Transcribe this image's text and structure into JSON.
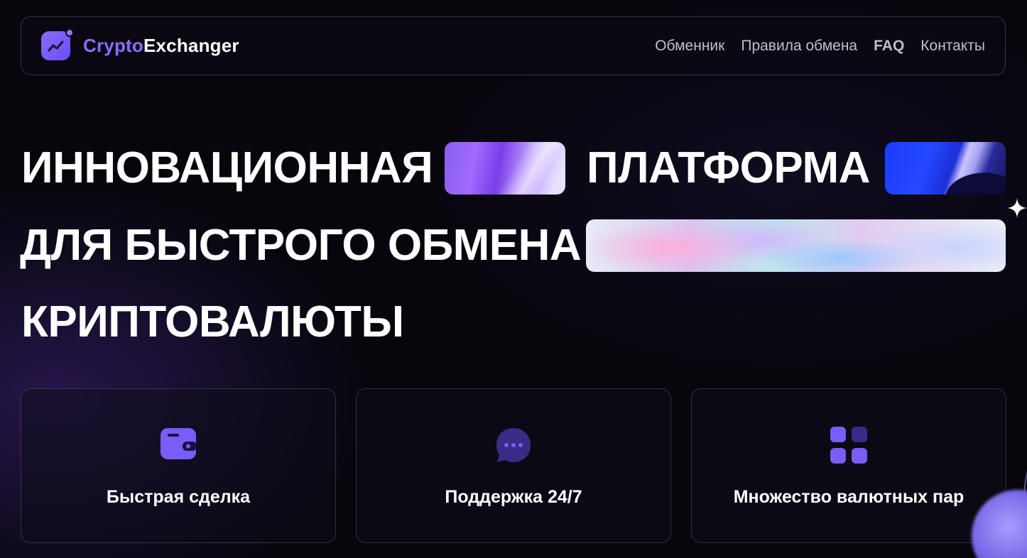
{
  "brand": {
    "name_accent": "Crypto",
    "name_rest": "Exchanger"
  },
  "nav": {
    "items": [
      {
        "label": "Обменник"
      },
      {
        "label": "Правила обмена"
      },
      {
        "label": "FAQ"
      },
      {
        "label": "Контакты"
      }
    ]
  },
  "hero": {
    "line1_word1": "ИННОВАЦИОННАЯ",
    "line1_word2": "ПЛАТФОРМА",
    "line2": "ДЛЯ БЫСТРОГО ОБМЕНА",
    "line3": "КРИПТОВАЛЮТЫ"
  },
  "features": [
    {
      "label": "Быстрая сделка",
      "icon": "wallet-icon"
    },
    {
      "label": "Поддержка 24/7",
      "icon": "chat-bubble-icon"
    },
    {
      "label": "Множество валютных пар",
      "icon": "grid-icon"
    }
  ],
  "colors": {
    "accent": "#8b6cff",
    "background": "#07060d",
    "nav_text": "#bfbfca"
  }
}
